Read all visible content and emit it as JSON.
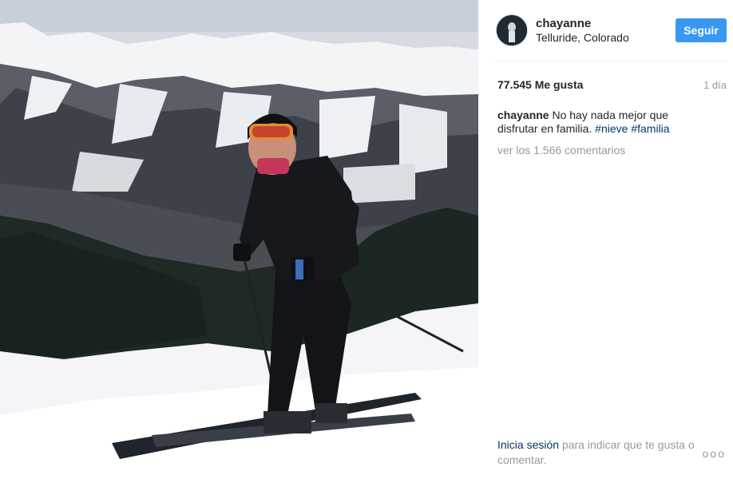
{
  "post": {
    "username": "chayanne",
    "location": "Telluride, Colorado",
    "follow_label": "Seguir",
    "likes": "77.545 Me gusta",
    "time_ago": "1 día",
    "caption": {
      "user": "chayanne",
      "text": "No hay nada mejor que disfrutar en familia.",
      "hashtags": [
        "#nieve",
        "#familia"
      ]
    },
    "view_comments": "ver los 1.566 comentarios",
    "login_prompt": {
      "link": "Inicia sesión",
      "text": "para indicar que te gusta o comentar."
    },
    "more_options": "ooo"
  },
  "colors": {
    "follow_button": "#3897f0",
    "hashtag": "#003569",
    "secondary_text": "#999999"
  }
}
